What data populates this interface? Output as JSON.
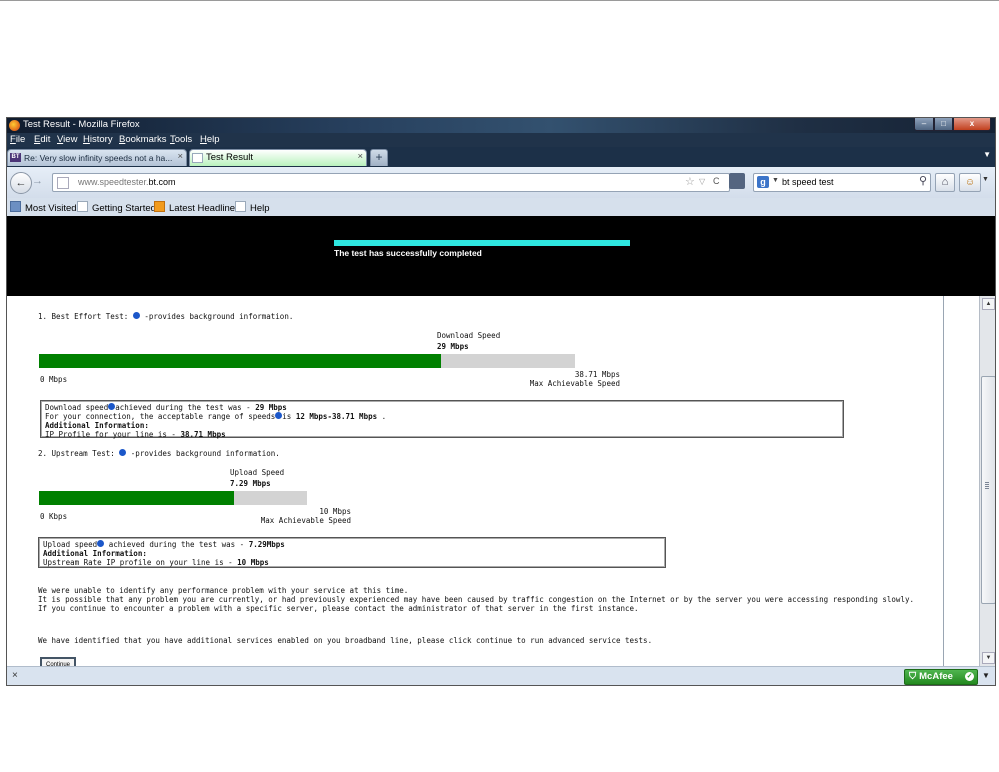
{
  "window": {
    "title": "Test Result - Mozilla Firefox",
    "min": "–",
    "max": "□",
    "close": "x"
  },
  "menu": [
    "File",
    "Edit",
    "View",
    "History",
    "Bookmarks",
    "Tools",
    "Help"
  ],
  "tabs": [
    {
      "favicon": "BT",
      "label": "Re: Very slow infinity speeds not a ha...",
      "close": "×"
    },
    {
      "label": "Test Result",
      "close": "×"
    }
  ],
  "newtab": "+",
  "tab_list_arrow": "▼",
  "nav": {
    "back": "←",
    "forward": "→",
    "url_prefix": "www.speedtester.",
    "url_domain": "bt.com",
    "star": "☆",
    "dropmarker": "▽",
    "reload": "C",
    "search_engine": "g",
    "search_arrow": "▼",
    "search_query": "bt speed test",
    "search_icon": "⚲",
    "home": "⌂",
    "addon": "☺",
    "addon_arrow": "▼"
  },
  "bookmarks": [
    "Most Visited",
    "Getting Started",
    "Latest Headlines",
    "Help"
  ],
  "page": {
    "progress_text": "The test has successfully completed",
    "best_effort": {
      "heading_pre": "1. Best Effort Test:",
      "heading_post": " -provides background information.",
      "speed_label": "Download Speed",
      "speed_value": "29 Mbps",
      "min_label": "0 Mbps",
      "max_value": "38.71 Mbps",
      "max_label": "Max Achievable Speed",
      "measured": 29,
      "maximum": 38.71,
      "box": {
        "line1_pre": "Download speed",
        "line1_mid": "achieved during the test was - ",
        "line1_val": "29 Mbps",
        "line2_pre": "For your connection, the acceptable range of speeds",
        "line2_mid": "is ",
        "line2_val": "12 Mbps-38.71 Mbps",
        "line2_end": " .",
        "line3": "Additional Information:",
        "line4_pre": "IP Profile for your line is - ",
        "line4_val": "38.71 Mbps"
      }
    },
    "upstream": {
      "heading_pre": "2. Upstream Test:",
      "heading_post": " -provides background information.",
      "speed_label": "Upload Speed",
      "speed_value": "7.29 Mbps",
      "min_label": "0 Kbps",
      "max_value": "10 Mbps",
      "max_label": "Max Achievable Speed",
      "measured": 7.29,
      "maximum": 10,
      "box": {
        "line1_pre": "Upload speed",
        "line1_mid": " achieved during the test was - ",
        "line1_val": "7.29Mbps",
        "line2": "Additional Information:",
        "line3_pre": "Upstream Rate IP profile on your line is - ",
        "line3_val": "10 Mbps"
      }
    },
    "summary": [
      "We were unable to identify any performance problem with your service at this time.",
      "It is possible that any problem you are currently, or had previously experienced may have been caused by traffic congestion on the Internet or by the server you were accessing responding slowly.",
      "If you continue to encounter a problem with a specific server, please contact the administrator of that server in the first instance."
    ],
    "advanced_text": "We have identified that you have additional services enabled on you broadband line, please click continue to run advanced service tests.",
    "continue_label": "Continue"
  },
  "scrollbar": {
    "up": "▲",
    "down": "▼"
  },
  "status": {
    "close": "×",
    "mcafee": "McAfee",
    "mcafee_check": "✓",
    "arrow": "▼"
  },
  "colors": {
    "progress": "#2ee6e0",
    "bar_fill": "#008000",
    "bar_track": "#d3d3d3",
    "band": "#000000",
    "mcafee": "#2f9e2b"
  }
}
